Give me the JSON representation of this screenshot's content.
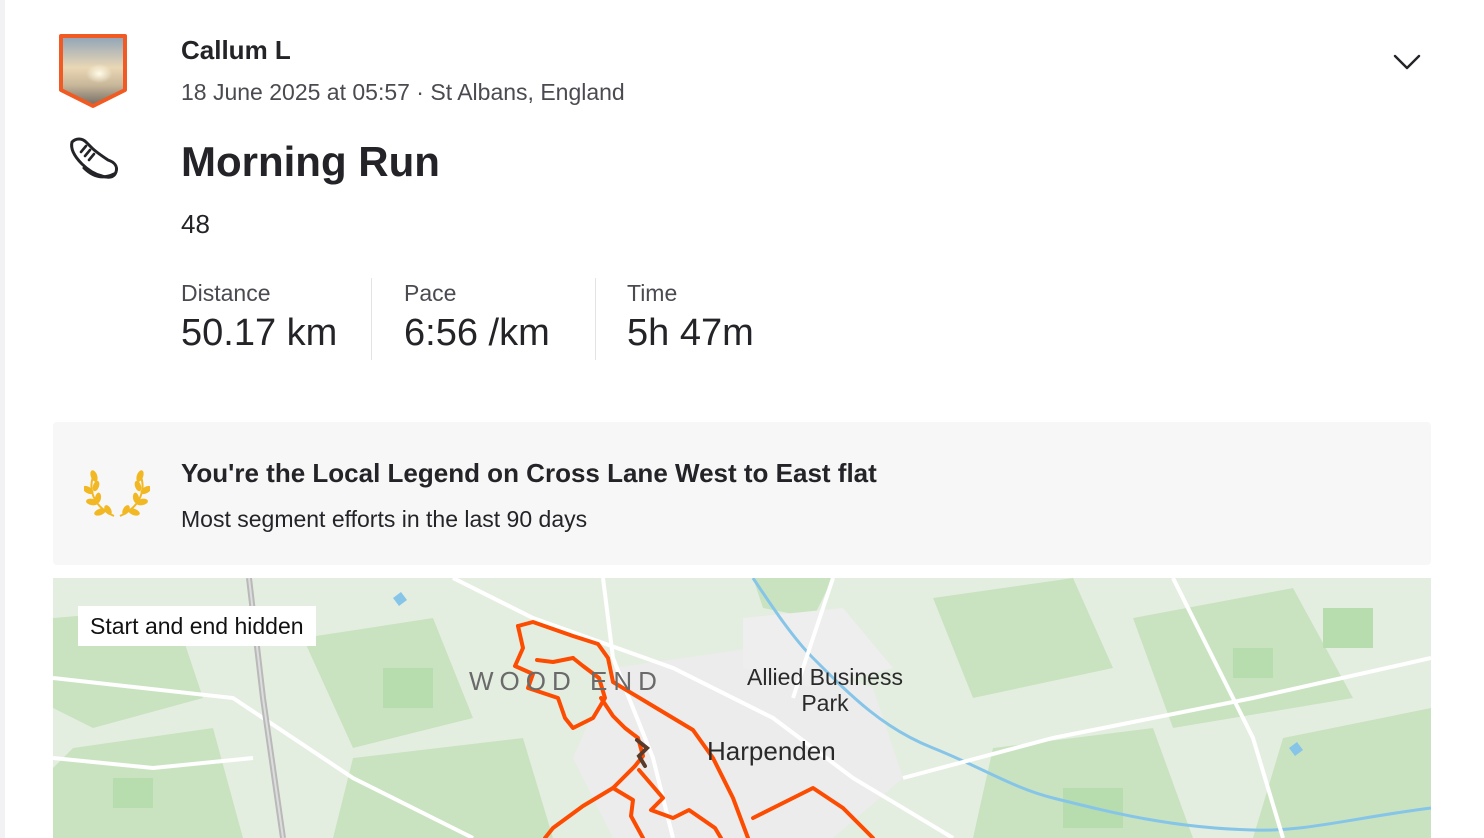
{
  "activity": {
    "athlete_name": "Callum L",
    "meta": "18 June 2025 at 05:57 · St Albans, England",
    "title": "Morning Run",
    "description": "48",
    "sport_icon": "running-shoe-icon"
  },
  "stats": [
    {
      "label": "Distance",
      "value": "50.17 km"
    },
    {
      "label": "Pace",
      "value": "6:56 /km"
    },
    {
      "label": "Time",
      "value": "5h 47m"
    }
  ],
  "local_legend": {
    "title": "You're the Local Legend on Cross Lane West to East flat",
    "subtitle": "Most segment efforts in the last 90 days",
    "icon": "laurel-icon",
    "icon_color": "#f2b824"
  },
  "map": {
    "badge": "Start and end hidden",
    "labels": {
      "wood_end": "WOOD END",
      "allied_line1": "Allied Business",
      "allied_line2": "Park",
      "harpenden": "Harpenden"
    },
    "route_color": "#fc4c02"
  }
}
